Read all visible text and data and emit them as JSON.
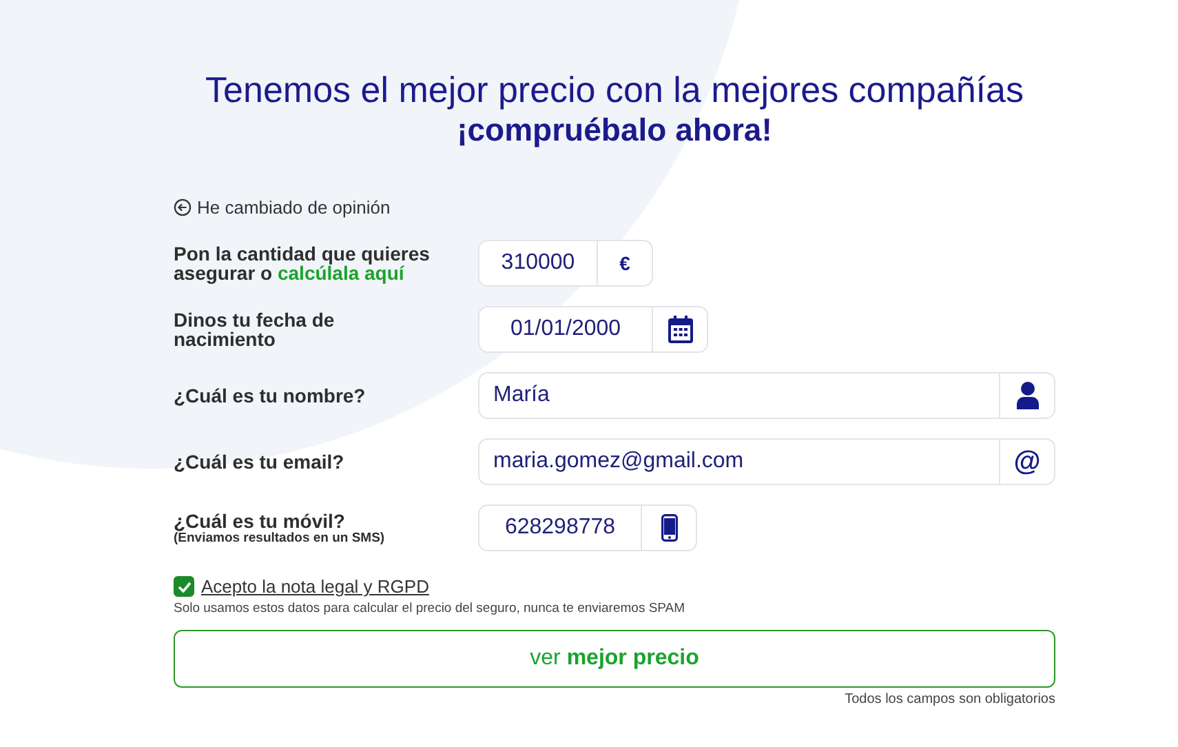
{
  "heading": {
    "line1": "Tenemos el mejor precio con la mejores compañías",
    "line2": "¡compruébalo ahora!"
  },
  "back_link": "He cambiado de opinión",
  "fields": [
    {
      "kind": "amount",
      "label": "Pon la cantidad que quieres asegurar o",
      "link": "calcúlala aquí",
      "value": "310000",
      "unit": "€"
    },
    {
      "kind": "date",
      "label": "Dinos tu fecha de nacimiento",
      "value": "01/01/2000"
    },
    {
      "kind": "name",
      "label": "¿Cuál es tu nombre?",
      "value": "María"
    },
    {
      "kind": "email",
      "label": "¿Cuál es tu email?",
      "value": "maria.gomez@gmail.com",
      "unit": "@"
    },
    {
      "kind": "phone",
      "label": "¿Cuál es tu móvil?",
      "sublabel": "(Enviamos resultados en un SMS)",
      "value": "628298778"
    }
  ],
  "consent": {
    "checked": true,
    "label": "Acepto la nota legal y RGPD"
  },
  "privacy_note": "Solo usamos estos datos para calcular el precio del seguro, nunca te enviaremos SPAM",
  "submit": "ver **mejor precio**",
  "required_note": "Todos los campos son obligatorios"
}
